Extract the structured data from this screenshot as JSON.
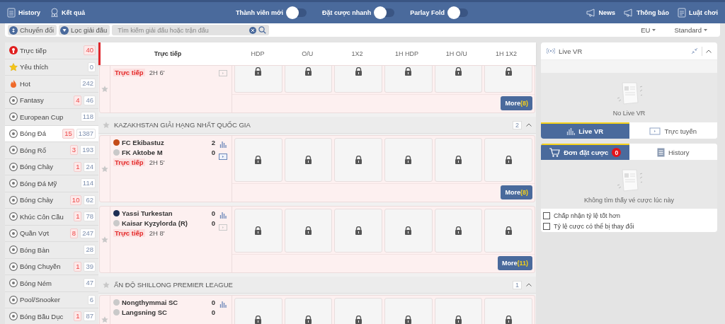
{
  "top_bar": {
    "links": [
      {
        "kind": "history",
        "label": "History"
      },
      {
        "kind": "results",
        "label": "Kết quả"
      }
    ],
    "toggles": [
      {
        "label": "Thành viên mới",
        "on": false
      },
      {
        "label": "Đặt cược nhanh",
        "on": false
      },
      {
        "label": "Parlay Fold",
        "on": false
      }
    ],
    "info_links": [
      {
        "kind": "news",
        "label": "News"
      },
      {
        "kind": "news",
        "label": "Thông báo"
      },
      {
        "kind": "rules",
        "label": "Luật chơi"
      }
    ]
  },
  "toolbar": {
    "buttons": [
      {
        "kind": "convert",
        "label": "Chuyển đổi"
      },
      {
        "kind": "filter",
        "label": "Lọc giải đấu"
      }
    ],
    "search": {
      "placeholder": "Tìm kiếm giải đấu hoặc trận đấu"
    },
    "dropdowns": [
      "EU",
      "Standard"
    ]
  },
  "sidebar": {
    "items": [
      {
        "kind": "live",
        "label": "Trực tiếp",
        "live_count": "40",
        "selected": false
      },
      {
        "kind": "favorite",
        "label": "Yêu thích",
        "count": "0",
        "selected": false
      },
      {
        "kind": "hot",
        "label": "Hot",
        "count": "242",
        "selected": false
      },
      {
        "kind": "sport",
        "label": "Fantasy",
        "live_count": "4",
        "count": "46",
        "selected": false
      },
      {
        "kind": "sport",
        "label": "European Cup",
        "count": "118",
        "selected": false
      },
      {
        "kind": "sport",
        "label": "Bóng Đá",
        "live_count": "15",
        "count": "1387",
        "selected": true
      },
      {
        "kind": "sport",
        "label": "Bóng Rổ",
        "live_count": "3",
        "count": "193",
        "selected": false
      },
      {
        "kind": "sport",
        "label": "Bóng Chày",
        "live_count": "1",
        "count": "24",
        "selected": false
      },
      {
        "kind": "sport",
        "label": "Bóng Đá Mỹ",
        "count": "114",
        "selected": false
      },
      {
        "kind": "sport",
        "label": "Bóng Chày",
        "live_count": "10",
        "count": "62",
        "selected": false
      },
      {
        "kind": "sport",
        "label": "Khúc Côn Cầu",
        "live_count": "1",
        "count": "78",
        "selected": false
      },
      {
        "kind": "sport",
        "label": "Quần Vợt",
        "live_count": "8",
        "count": "247",
        "selected": false
      },
      {
        "kind": "sport",
        "label": "Bóng Bàn",
        "count": "28",
        "selected": false
      },
      {
        "kind": "sport",
        "label": "Bóng Chuyền",
        "live_count": "1",
        "count": "39",
        "selected": false
      },
      {
        "kind": "sport",
        "label": "Bóng Ném",
        "count": "47",
        "selected": false
      },
      {
        "kind": "sport",
        "label": "Pool/Snooker",
        "count": "6",
        "selected": false
      },
      {
        "kind": "sport",
        "label": "Bóng Bầu Dục",
        "live_count": "1",
        "count": "87",
        "selected": false
      }
    ]
  },
  "odds_table": {
    "title": "Trực tiếp",
    "columns": [
      "HDP",
      "O/U",
      "1X2",
      "1H HDP",
      "1H O/U",
      "1H 1X2"
    ]
  },
  "leagues": [
    {
      "matches": [
        {
          "status": "Trực tiếp",
          "time": "2H 6'",
          "stream": false,
          "more": "More",
          "more_count": "(8)"
        }
      ]
    },
    {
      "name": "KAZAKHSTAN GIẢI HẠNG NHẤT QUỐC GIA",
      "count": "2",
      "matches": [
        {
          "home": "FC Ekibastuz",
          "home_score": "2",
          "away": "FK Aktobe M",
          "away_score": "0",
          "status": "Trực tiếp",
          "time": "2H 5'",
          "stream": true,
          "more": "More",
          "more_count": "(8)"
        },
        {
          "home": "Yassi Turkestan",
          "home_score": "0",
          "away": "Kaisar Kyzylorda (R)",
          "away_score": "0",
          "status": "Trực tiếp",
          "time": "2H 8'",
          "stream": false,
          "more": "More",
          "more_count": "(11)"
        }
      ]
    },
    {
      "name": "ẤN ĐỘ SHILLONG PREMIER LEAGUE",
      "count": "1",
      "matches": [
        {
          "home": "Nongthymmai SC",
          "home_score": "0",
          "away": "Langsning SC",
          "away_score": "0"
        }
      ]
    }
  ],
  "live_vr": {
    "title": "Live VR",
    "empty": "No Live VR",
    "tabs": [
      {
        "kind": "stats",
        "label": "Live VR",
        "selected": true
      },
      {
        "kind": "tv",
        "label": "Trực tuyến",
        "selected": false
      }
    ]
  },
  "bet_slip": {
    "tabs": [
      {
        "kind": "cart",
        "label": "Đơn đặt cược",
        "badge": "0",
        "selected": true
      },
      {
        "kind": "list",
        "label": "History",
        "selected": false
      }
    ],
    "empty": "Không tìm thấy vé cược lúc này",
    "options": [
      {
        "label": "Chấp nhận tỷ lệ tốt hơn",
        "checked": false
      },
      {
        "label": "Tỷ lệ cược có thể bị thay đổi",
        "checked": false
      }
    ]
  }
}
